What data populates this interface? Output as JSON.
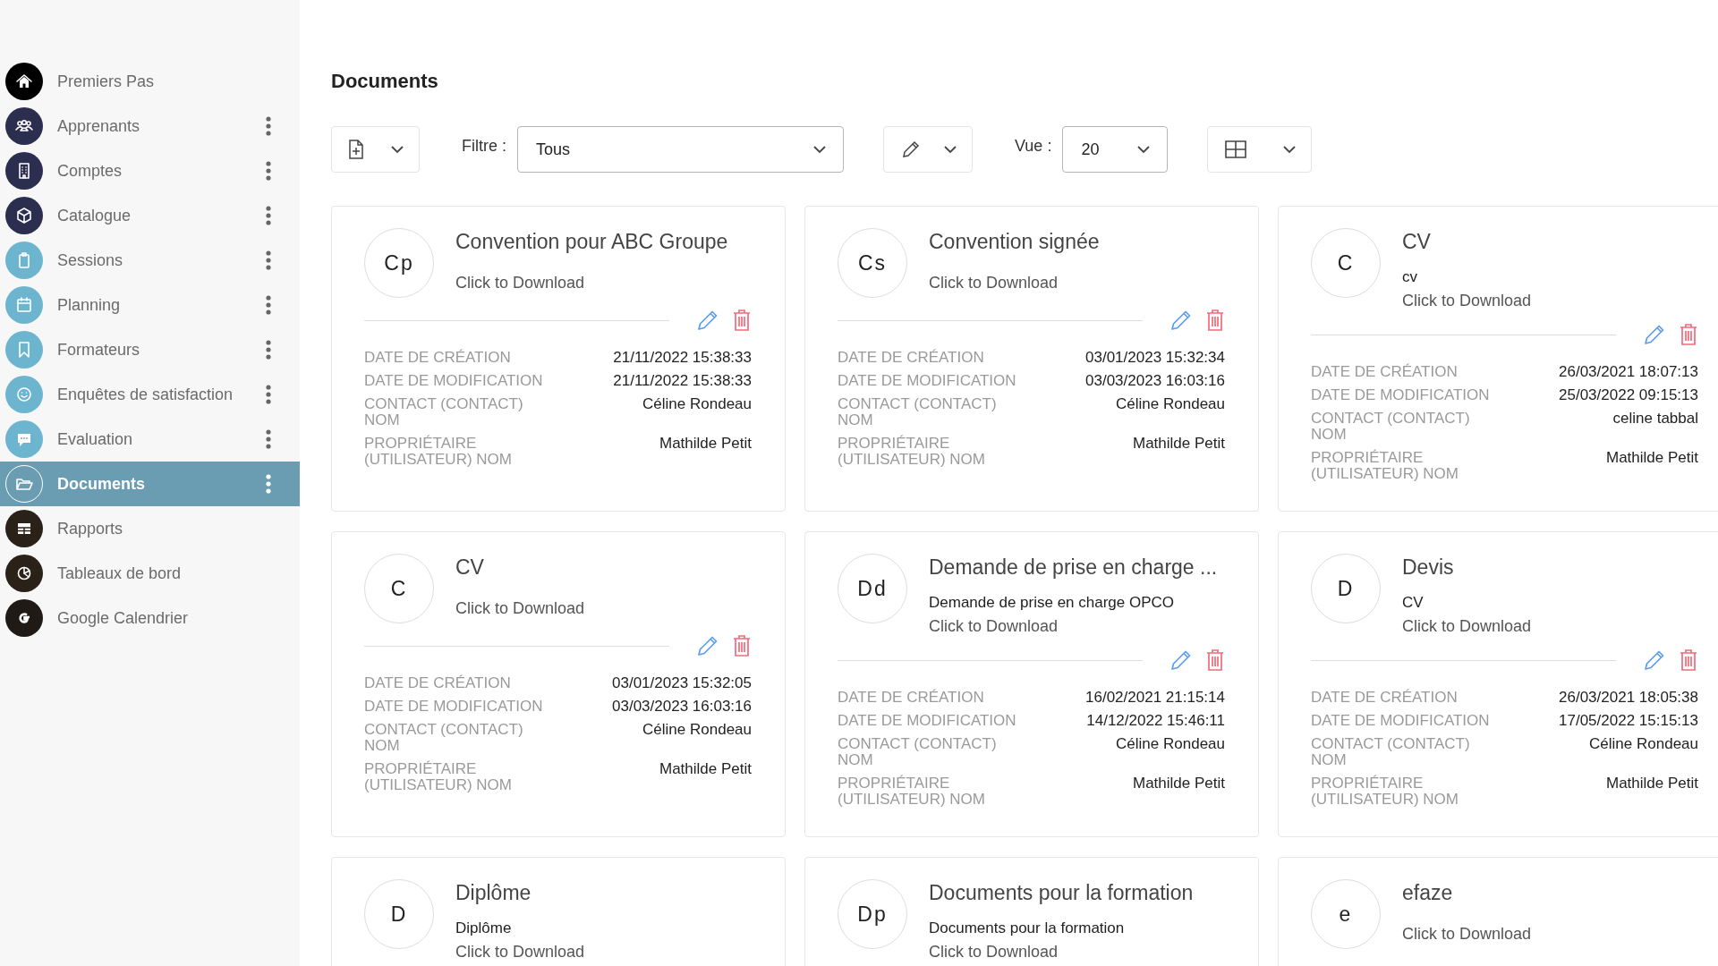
{
  "sidebar": {
    "items": [
      {
        "label": "Premiers Pas",
        "color": "#000000",
        "menu": false,
        "selected": false
      },
      {
        "label": "Apprenants",
        "color": "#2b2e4f",
        "menu": true,
        "selected": false
      },
      {
        "label": "Comptes",
        "color": "#2b2e4f",
        "menu": true,
        "selected": false
      },
      {
        "label": "Catalogue",
        "color": "#2b2e4f",
        "menu": true,
        "selected": false
      },
      {
        "label": "Sessions",
        "color": "#6db5cf",
        "menu": true,
        "selected": false
      },
      {
        "label": "Planning",
        "color": "#6db5cf",
        "menu": true,
        "selected": false
      },
      {
        "label": "Formateurs",
        "color": "#6db5cf",
        "menu": true,
        "selected": false
      },
      {
        "label": "Enquêtes de satisfaction",
        "color": "#6db5cf",
        "menu": true,
        "selected": false
      },
      {
        "label": "Evaluation",
        "color": "#6db5cf",
        "menu": true,
        "selected": false
      },
      {
        "label": "Documents",
        "color": "#6a9db2",
        "menu": true,
        "selected": true
      },
      {
        "label": "Rapports",
        "color": "#2a2118",
        "menu": false,
        "selected": false
      },
      {
        "label": "Tableaux de bord",
        "color": "#2a2118",
        "menu": false,
        "selected": false
      },
      {
        "label": "Google Calendrier",
        "color": "#1f1a15",
        "menu": false,
        "selected": false
      }
    ]
  },
  "page_title": "Documents",
  "toolbar": {
    "filter_label": "Filtre :",
    "filter_value": "Tous",
    "view_label": "Vue :",
    "view_value": "20"
  },
  "cards": [
    {
      "initials": "Cp",
      "title": "Convention pour ABC Groupe",
      "download": "Click to Download",
      "fields": [
        {
          "label": "DATE DE CRÉATION",
          "value": "21/11/2022 15:38:33"
        },
        {
          "label": "DATE DE MODIFICATION",
          "value": "21/11/2022 15:38:33"
        },
        {
          "label": "CONTACT (CONTACT) NOM",
          "value": "Céline Rondeau"
        },
        {
          "label": "PROPRIÉTAIRE (UTILISATEUR) NOM",
          "value": "Mathilde Petit"
        }
      ]
    },
    {
      "initials": "Cs",
      "title": "Convention signée",
      "download": "Click to Download",
      "fields": [
        {
          "label": "DATE DE CRÉATION",
          "value": "03/01/2023 15:32:34"
        },
        {
          "label": "DATE DE MODIFICATION",
          "value": "03/03/2023 16:03:16"
        },
        {
          "label": "CONTACT (CONTACT) NOM",
          "value": "Céline Rondeau"
        },
        {
          "label": "PROPRIÉTAIRE (UTILISATEUR) NOM",
          "value": "Mathilde Petit"
        }
      ]
    },
    {
      "initials": "C",
      "title": "CV",
      "subtitle": "cv",
      "download": "Click to Download",
      "fields": [
        {
          "label": "DATE DE CRÉATION",
          "value": "26/03/2021 18:07:13"
        },
        {
          "label": "DATE DE MODIFICATION",
          "value": "25/03/2022 09:15:13"
        },
        {
          "label": "CONTACT (CONTACT) NOM",
          "value": "celine tabbal"
        },
        {
          "label": "PROPRIÉTAIRE (UTILISATEUR) NOM",
          "value": "Mathilde Petit"
        }
      ]
    },
    {
      "initials": "C",
      "title": "CV",
      "download": "Click to Download",
      "fields": [
        {
          "label": "DATE DE CRÉATION",
          "value": "03/01/2023 15:32:05"
        },
        {
          "label": "DATE DE MODIFICATION",
          "value": "03/03/2023 16:03:16"
        },
        {
          "label": "CONTACT (CONTACT) NOM",
          "value": "Céline Rondeau"
        },
        {
          "label": "PROPRIÉTAIRE (UTILISATEUR) NOM",
          "value": "Mathilde Petit"
        }
      ]
    },
    {
      "initials": "Dd",
      "title": "Demande de prise en charge ...",
      "subtitle": "Demande de prise en charge OPCO",
      "download": "Click to Download",
      "fields": [
        {
          "label": "DATE DE CRÉATION",
          "value": "16/02/2021 21:15:14"
        },
        {
          "label": "DATE DE MODIFICATION",
          "value": "14/12/2022 15:46:11"
        },
        {
          "label": "CONTACT (CONTACT) NOM",
          "value": "Céline Rondeau"
        },
        {
          "label": "PROPRIÉTAIRE (UTILISATEUR) NOM",
          "value": "Mathilde Petit"
        }
      ]
    },
    {
      "initials": "D",
      "title": "Devis",
      "subtitle": "CV",
      "download": "Click to Download",
      "fields": [
        {
          "label": "DATE DE CRÉATION",
          "value": "26/03/2021 18:05:38"
        },
        {
          "label": "DATE DE MODIFICATION",
          "value": "17/05/2022 15:15:13"
        },
        {
          "label": "CONTACT (CONTACT) NOM",
          "value": "Céline Rondeau"
        },
        {
          "label": "PROPRIÉTAIRE (UTILISATEUR) NOM",
          "value": "Mathilde Petit"
        }
      ]
    },
    {
      "initials": "D",
      "title": "Diplôme",
      "subtitle": "Diplôme",
      "download": "Click to Download"
    },
    {
      "initials": "Dp",
      "title": "Documents pour la formation",
      "subtitle": "Documents pour la formation",
      "download": "Click to Download"
    },
    {
      "initials": "e",
      "title": "efaze",
      "download": "Click to Download"
    }
  ]
}
